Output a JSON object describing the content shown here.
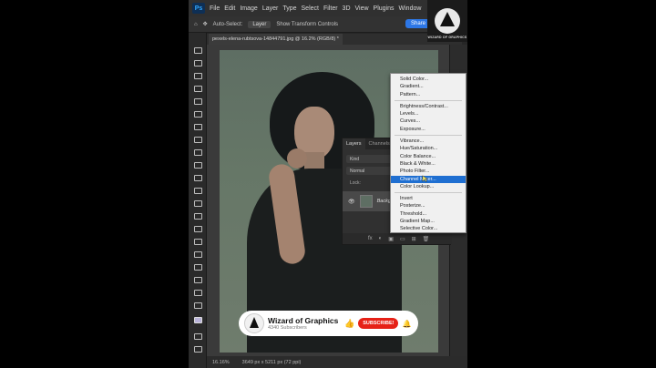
{
  "menubar": {
    "logo": "Ps",
    "items": [
      "File",
      "Edit",
      "Image",
      "Layer",
      "Type",
      "Select",
      "Filter",
      "3D",
      "View",
      "Plugins",
      "Window"
    ]
  },
  "options": {
    "auto_select": "Auto-Select:",
    "layer_value": "Layer",
    "transform": "Show Transform Controls",
    "share": "Share"
  },
  "brand": {
    "label": "WIZARD OF GRAPHICS"
  },
  "document": {
    "tab_title": "pexels-elena-rubtsova-14844791.jpg @ 16.2% (RGB/8) *"
  },
  "status": {
    "zoom": "16.16%",
    "size": "3649 px x 5211 px (72 ppi)"
  },
  "layers_panel": {
    "tabs": [
      "Layers",
      "Channels"
    ],
    "search": "Kind",
    "blend": "Normal",
    "lock": "Lock:",
    "layer_name": "Backgr...",
    "footer_icons": [
      "fx",
      "◐",
      "▣",
      "▭",
      "⊞",
      "🗑"
    ]
  },
  "adjustment_menu": {
    "groups": [
      [
        "Solid Color...",
        "Gradient...",
        "Pattern..."
      ],
      [
        "Brightness/Contrast...",
        "Levels...",
        "Curves...",
        "Exposure..."
      ],
      [
        "Vibrance...",
        "Hue/Saturation...",
        "Color Balance...",
        "Black & White...",
        "Photo Filter...",
        "Channel Mixer...",
        "Color Lookup..."
      ],
      [
        "Invert",
        "Posterize...",
        "Threshold...",
        "Gradient Map...",
        "Selective Color..."
      ]
    ],
    "highlighted": "Channel Mixer..."
  },
  "subscribe_banner": {
    "channel": "Wizard of Graphics",
    "subscribers": "4340 Subscribers",
    "button": "SUBSCRIBE!"
  },
  "colors": {
    "highlight": "#1f6fd1",
    "share": "#2d77e6",
    "subscribe": "#e62117"
  }
}
